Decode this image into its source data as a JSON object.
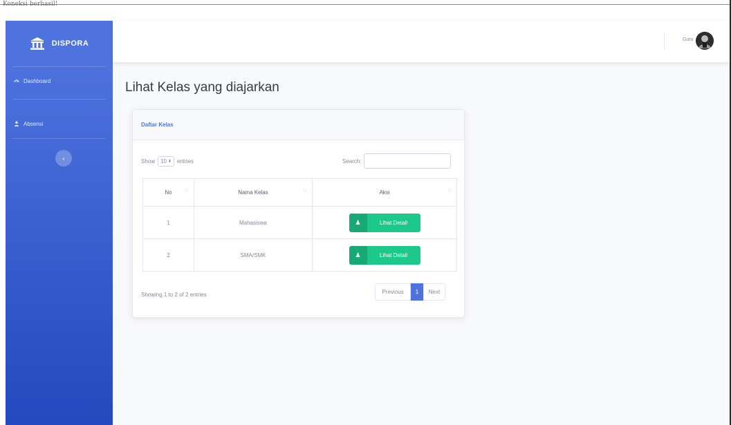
{
  "alert": {
    "text": "Koneksi berhasil!"
  },
  "sidebar": {
    "brand": "DISPORA",
    "items": [
      {
        "label": "Dashboard",
        "icon": "tachometer-icon"
      },
      {
        "label": "Absensi",
        "icon": "user-icon"
      }
    ],
    "toggle_icon": "chevron-left-icon"
  },
  "topbar": {
    "user_name": "Guru"
  },
  "page": {
    "title": "Lihat Kelas yang diajarkan"
  },
  "card": {
    "title": "Daftar Kelas",
    "show_prefix": "Show",
    "page_length": "10",
    "show_suffix": "entries",
    "search_label": "Search:",
    "search_value": "",
    "columns": [
      "No",
      "Nama Kelas",
      "Aksi"
    ],
    "rows": [
      {
        "no": "1",
        "nama": "Mahasiswa",
        "action": "Lihat Detail"
      },
      {
        "no": "2",
        "nama": "SMA/SMK",
        "action": "Lihat Detail"
      }
    ],
    "info": "Showing 1 to 2 of 2 entries",
    "pagination": {
      "previous": "Previous",
      "current": "1",
      "next": "Next"
    }
  },
  "colors": {
    "sidebar_start": "#4e73df",
    "sidebar_end": "#224abe",
    "primary": "#4e73df",
    "success": "#1cc88a",
    "background": "#f8f9fc"
  }
}
